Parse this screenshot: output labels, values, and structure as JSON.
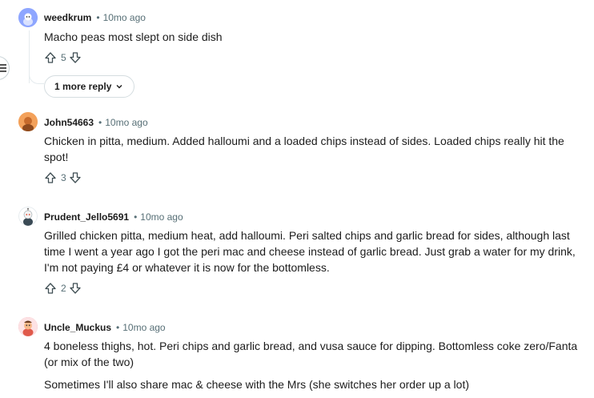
{
  "comments": [
    {
      "author": "weedkrum",
      "time": "10mo ago",
      "body": [
        "Macho peas most slept on side dish"
      ],
      "votes": "5",
      "more_replies": "1 more reply",
      "avatar_color": "#8ea6ff"
    },
    {
      "author": "John54663",
      "time": "10mo ago",
      "body": [
        "Chicken in pitta, medium. Added halloumi and a loaded chips instead of sides. Loaded chips really hit the spot!"
      ],
      "votes": "3",
      "avatar_color": "#f3a15a"
    },
    {
      "author": "Prudent_Jello5691",
      "time": "10mo ago",
      "body": [
        "Grilled chicken pitta, medium heat, add halloumi. Peri salted chips and garlic bread for sides, although last time I went a year ago I got the peri mac and cheese instead of garlic bread. Just grab a water for my drink, I'm not paying £4 or whatever it is now for the bottomless."
      ],
      "votes": "2",
      "avatar_color": "#ffffff"
    },
    {
      "author": "Uncle_Muckus",
      "time": "10mo ago",
      "body": [
        "4 boneless thighs, hot. Peri chips and garlic bread, and vusa sauce for dipping. Bottomless coke zero/Fanta (or mix of the two)",
        "Sometimes I'll also share mac & cheese with the Mrs (she switches her order up a lot)"
      ],
      "avatar_color": "#f2a0a8"
    }
  ],
  "dot": "•",
  "colors": {
    "meta": "#576f76",
    "line": "#e5ebee",
    "border": "#d5dde0"
  }
}
